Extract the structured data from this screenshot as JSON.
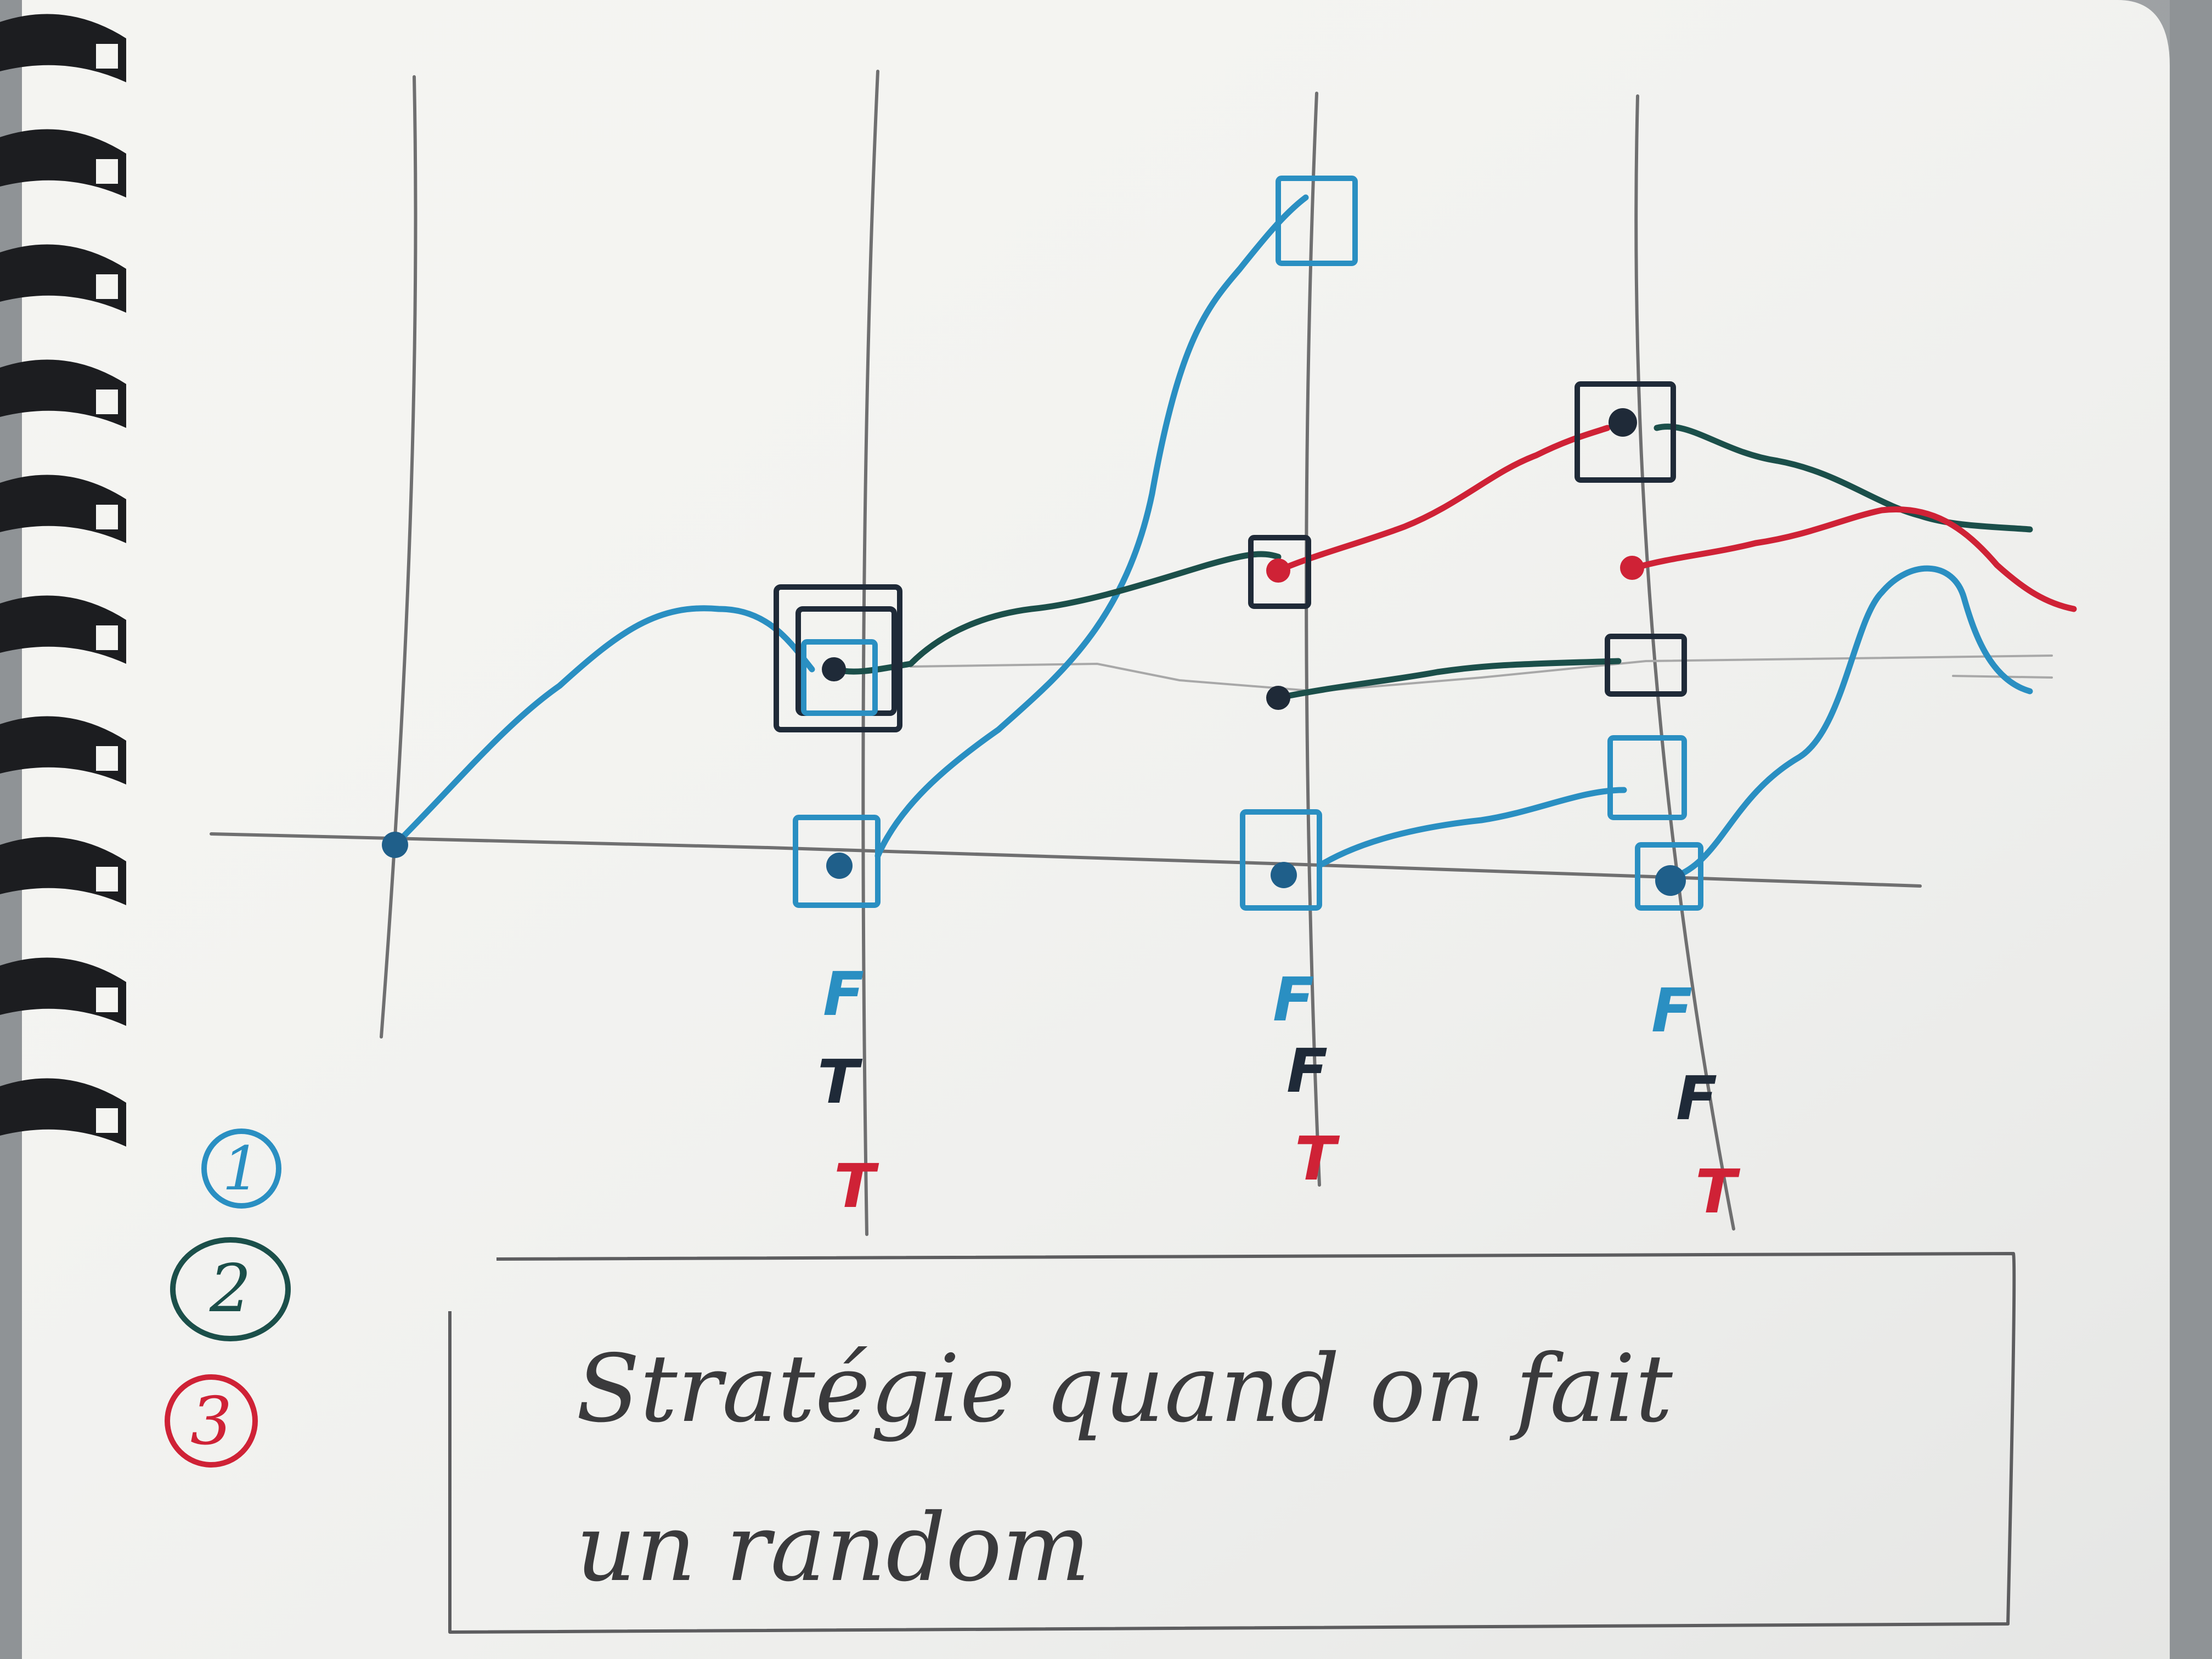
{
  "colors": {
    "paper": "#f4f4f1",
    "pencil": "#6f6f70",
    "blue": "#2a8fc2",
    "green": "#1b4f4a",
    "red": "#cf2236",
    "ink": "#1f2a38"
  },
  "legend": [
    {
      "number": "1",
      "color": "#2a8fc2"
    },
    {
      "number": "2",
      "color": "#1b4f4a"
    },
    {
      "number": "3",
      "color": "#cf2236"
    }
  ],
  "columns": [
    {
      "labels": [
        {
          "text": "F",
          "color": "#2a8fc2"
        },
        {
          "text": "T",
          "color": "#1f2a38"
        },
        {
          "text": "T",
          "color": "#cf2236"
        }
      ]
    },
    {
      "labels": [
        {
          "text": "F",
          "color": "#2a8fc2"
        },
        {
          "text": "F",
          "color": "#1f2a38"
        },
        {
          "text": "T",
          "color": "#cf2236"
        }
      ]
    },
    {
      "labels": [
        {
          "text": "F",
          "color": "#2a8fc2"
        },
        {
          "text": "F",
          "color": "#1f2a38"
        },
        {
          "text": "T",
          "color": "#cf2236"
        }
      ]
    }
  ],
  "caption": {
    "line1": "Stratégie quand on fait",
    "line2": "un random"
  },
  "icons": [
    "spiral-binding-icon"
  ]
}
